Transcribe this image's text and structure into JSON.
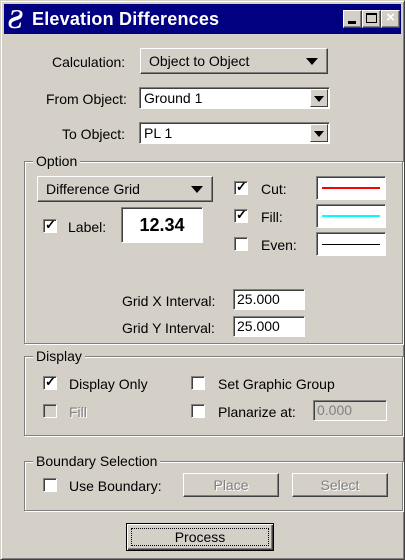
{
  "window": {
    "title": "Elevation Differences",
    "app_icon": "geopak-logo-icon"
  },
  "calculation": {
    "label": "Calculation:",
    "value": "Object to Object"
  },
  "from_object": {
    "label": "From Object:",
    "value": "Ground 1"
  },
  "to_object": {
    "label": "To Object:",
    "value": "PL 1"
  },
  "option": {
    "legend": "Option",
    "mode": "Difference Grid",
    "label_checkbox": {
      "label": "Label:",
      "checked": true
    },
    "label_preview": "12.34",
    "cut": {
      "label": "Cut:",
      "checked": true,
      "color": "#ff0000"
    },
    "fill": {
      "label": "Fill:",
      "checked": true,
      "color": "#00ffff"
    },
    "even": {
      "label": "Even:",
      "checked": false,
      "color": "#000000"
    },
    "grid_x": {
      "label": "Grid X Interval:",
      "value": "25.000"
    },
    "grid_y": {
      "label": "Grid Y Interval:",
      "value": "25.000"
    }
  },
  "display": {
    "legend": "Display",
    "display_only": {
      "label": "Display Only",
      "checked": true
    },
    "fill": {
      "label": "Fill",
      "checked": false,
      "disabled": true
    },
    "set_graphic_group": {
      "label": "Set Graphic Group",
      "checked": false
    },
    "planarize": {
      "label": "Planarize at:",
      "checked": false,
      "value": "0.000"
    }
  },
  "boundary": {
    "legend": "Boundary Selection",
    "use_boundary": {
      "label": "Use Boundary:",
      "checked": false
    },
    "place_label": "Place",
    "select_label": "Select"
  },
  "process_label": "Process"
}
